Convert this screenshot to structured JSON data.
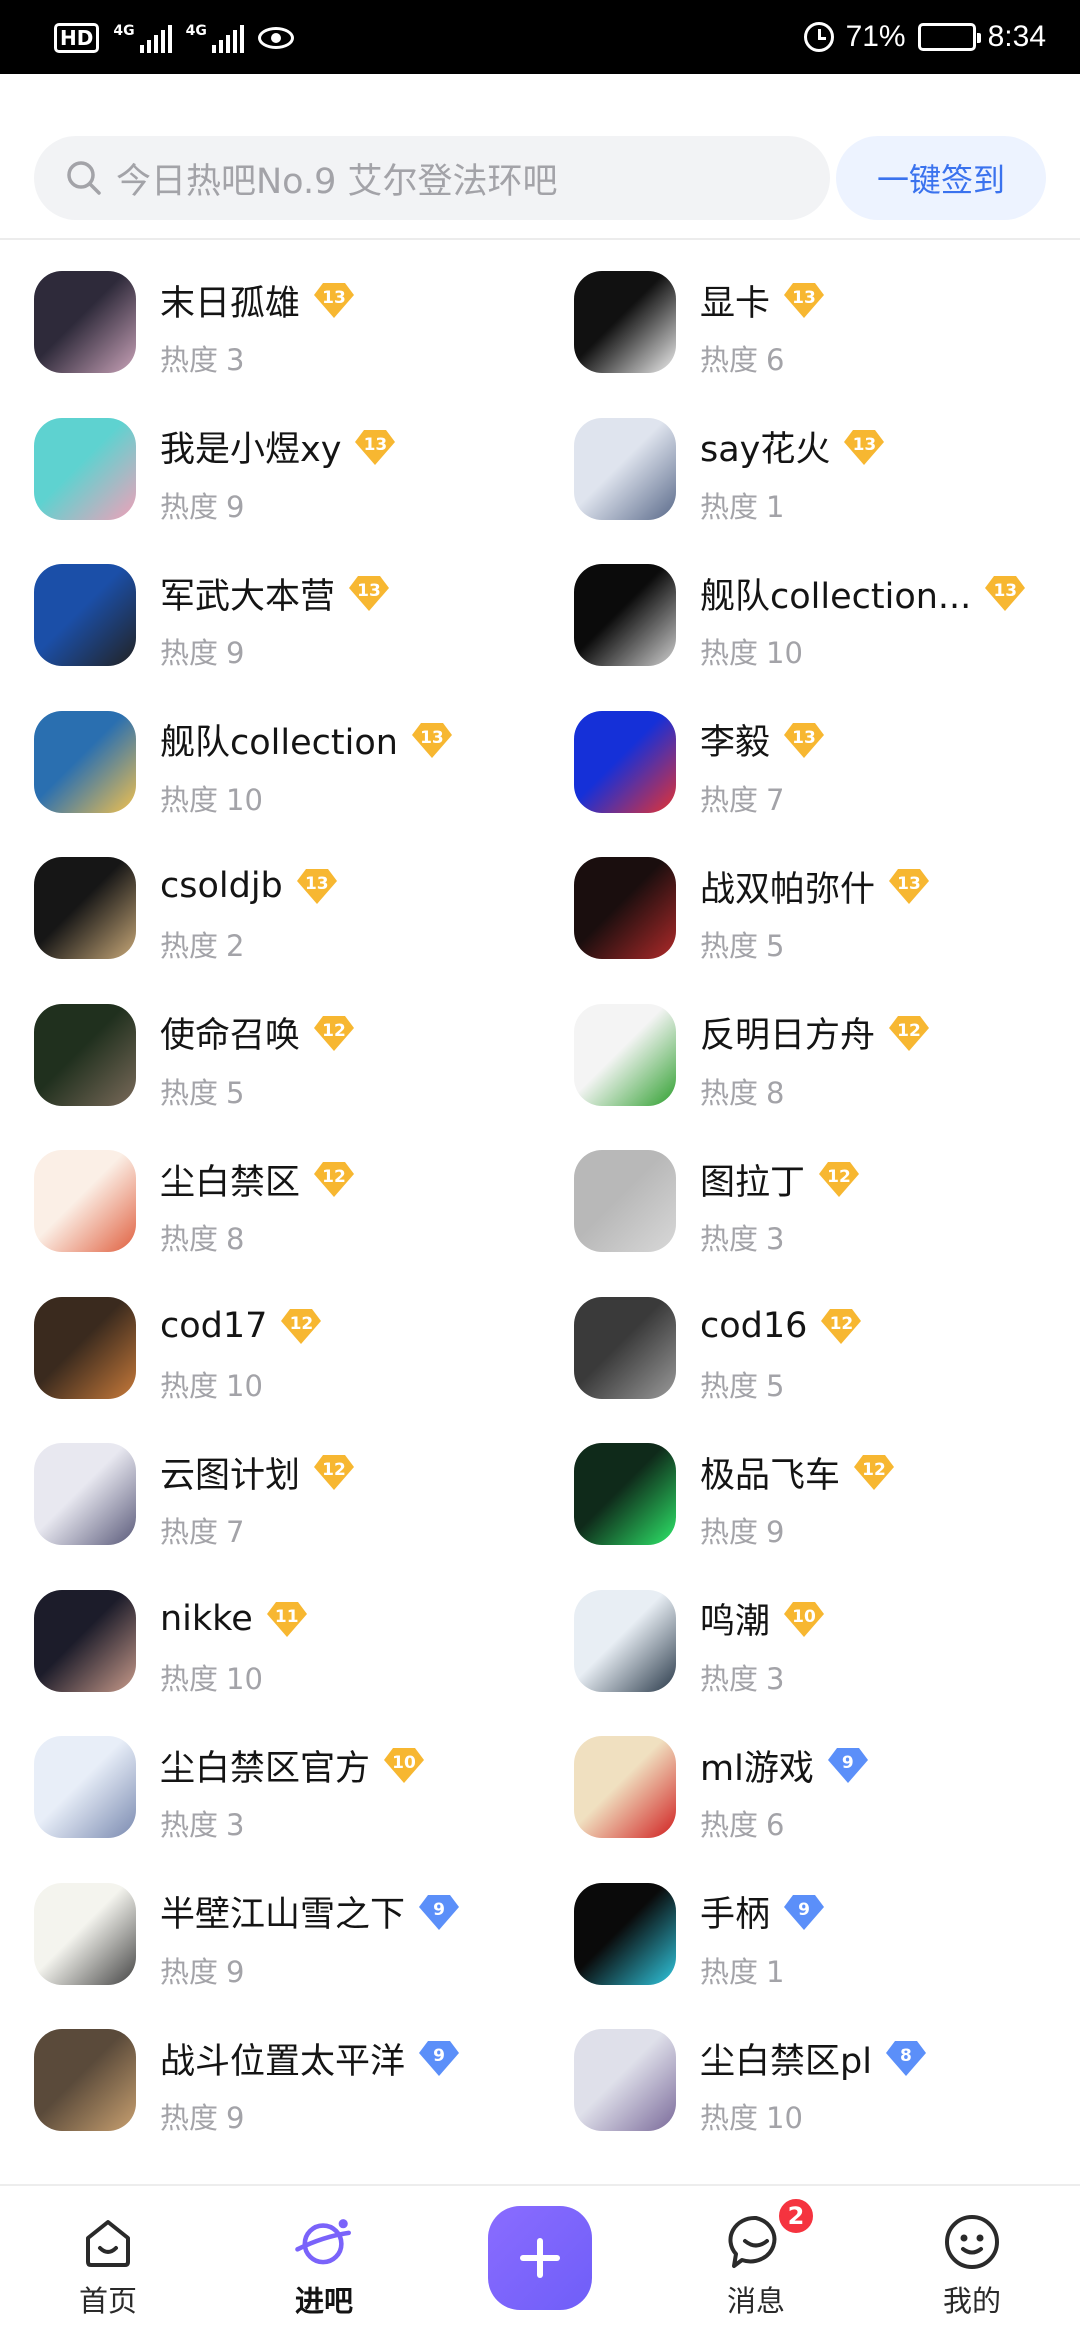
{
  "status_bar": {
    "hd": "HD",
    "net1": "4G",
    "net2": "4G",
    "battery": "71%",
    "battery_level": 0.71,
    "time": "8:34"
  },
  "search": {
    "placeholder": "今日热吧No.9 艾尔登法环吧",
    "signin_label": "一键签到"
  },
  "heat_label": "热度",
  "forums": [
    {
      "name": "末日孤雄",
      "level": "13",
      "heat": "3",
      "badge": "gold",
      "color1": "#2e2a3a",
      "color2": "#c9a2b8"
    },
    {
      "name": "显卡",
      "level": "13",
      "heat": "6",
      "badge": "gold",
      "color1": "#111111",
      "color2": "#eeeeee"
    },
    {
      "name": "我是小煜xy",
      "level": "13",
      "heat": "9",
      "badge": "gold",
      "color1": "#5ed2d0",
      "color2": "#f0a0b8"
    },
    {
      "name": "say花火",
      "level": "13",
      "heat": "1",
      "badge": "gold",
      "color1": "#dfe4ee",
      "color2": "#5a6a8a"
    },
    {
      "name": "军武大本营",
      "level": "13",
      "heat": "9",
      "badge": "gold",
      "color1": "#1b4fa8",
      "color2": "#222222"
    },
    {
      "name": "舰队collection...",
      "level": "13",
      "heat": "10",
      "badge": "gold",
      "color1": "#0b0b0b",
      "color2": "#d0d0d0"
    },
    {
      "name": "舰队collection",
      "level": "13",
      "heat": "10",
      "badge": "gold",
      "color1": "#2a6fb0",
      "color2": "#f2c14e"
    },
    {
      "name": "李毅",
      "level": "13",
      "heat": "7",
      "badge": "gold",
      "color1": "#1530d8",
      "color2": "#e63232"
    },
    {
      "name": "csoldjb",
      "level": "13",
      "heat": "2",
      "badge": "gold",
      "color1": "#161616",
      "color2": "#c8a878"
    },
    {
      "name": "战双帕弥什",
      "level": "13",
      "heat": "5",
      "badge": "gold",
      "color1": "#1a0e0e",
      "color2": "#b02a2a"
    },
    {
      "name": "使命召唤",
      "level": "12",
      "heat": "5",
      "badge": "gold",
      "color1": "#20301e",
      "color2": "#7a6a5a"
    },
    {
      "name": "反明日方舟",
      "level": "12",
      "heat": "8",
      "badge": "gold",
      "color1": "#f4f4f4",
      "color2": "#30a030"
    },
    {
      "name": "尘白禁区",
      "level": "12",
      "heat": "8",
      "badge": "gold",
      "color1": "#fbefe6",
      "color2": "#e06040"
    },
    {
      "name": "图拉丁",
      "level": "12",
      "heat": "3",
      "badge": "gold",
      "color1": "#b8b8b8",
      "color2": "#d8d8d8"
    },
    {
      "name": "cod17",
      "level": "12",
      "heat": "10",
      "badge": "gold",
      "color1": "#3a2a1e",
      "color2": "#c87a3a"
    },
    {
      "name": "cod16",
      "level": "12",
      "heat": "5",
      "badge": "gold",
      "color1": "#3a3a3a",
      "color2": "#9a9a9a"
    },
    {
      "name": "云图计划",
      "level": "12",
      "heat": "7",
      "badge": "gold",
      "color1": "#e8e8f0",
      "color2": "#5a5a7a"
    },
    {
      "name": "极品飞车",
      "level": "12",
      "heat": "9",
      "badge": "gold",
      "color1": "#0f2a1a",
      "color2": "#2ee86a"
    },
    {
      "name": "nikke",
      "level": "11",
      "heat": "10",
      "badge": "gold",
      "color1": "#1c1c2a",
      "color2": "#c89a8a"
    },
    {
      "name": "鸣潮",
      "level": "10",
      "heat": "3",
      "badge": "gold",
      "color1": "#e8eef4",
      "color2": "#2a3a4a"
    },
    {
      "name": "尘白禁区官方",
      "level": "10",
      "heat": "3",
      "badge": "gold",
      "color1": "#e8eef8",
      "color2": "#7a8ab0"
    },
    {
      "name": "ml游戏",
      "level": "9",
      "heat": "6",
      "badge": "blue",
      "color1": "#f0e0c0",
      "color2": "#d02020"
    },
    {
      "name": "半壁江山雪之下",
      "level": "9",
      "heat": "9",
      "badge": "blue",
      "color1": "#f4f4ee",
      "color2": "#444444"
    },
    {
      "name": "手柄",
      "level": "9",
      "heat": "1",
      "badge": "blue",
      "color1": "#0a0a0a",
      "color2": "#30c8e0"
    },
    {
      "name": "战斗位置太平洋",
      "level": "9",
      "heat": "9",
      "badge": "blue",
      "color1": "#5a4a3a",
      "color2": "#c8a070"
    },
    {
      "name": "尘白禁区pl",
      "level": "8",
      "heat": "10",
      "badge": "blue",
      "color1": "#dfe0ea",
      "color2": "#7a6a9a"
    }
  ],
  "nav": {
    "home": "首页",
    "enter": "进吧",
    "messages": "消息",
    "messages_badge": "2",
    "mine": "我的"
  },
  "colors": {
    "accent": "#3a72ee",
    "post_button": "#7a63fa",
    "gold_badge": "#f7b731",
    "blue_badge": "#5b8ff9",
    "unread": "#f5333f"
  }
}
